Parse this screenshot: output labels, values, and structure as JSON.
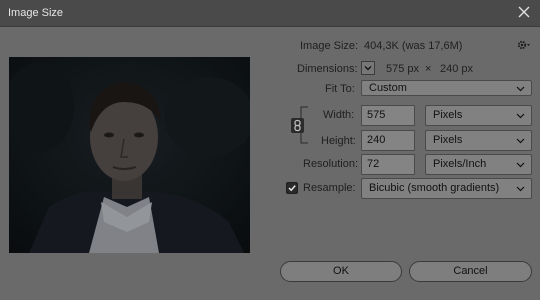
{
  "window": {
    "title": "Image Size"
  },
  "image_size": {
    "label": "Image Size:",
    "value": "404,3K (was 17,6M)"
  },
  "dimensions": {
    "label": "Dimensions:",
    "width_value": "575 px",
    "times": "×",
    "height_value": "240 px"
  },
  "fit_to": {
    "label": "Fit To:",
    "value": "Custom"
  },
  "width": {
    "label": "Width:",
    "value": "575",
    "unit": "Pixels"
  },
  "height": {
    "label": "Height:",
    "value": "240",
    "unit": "Pixels"
  },
  "resolution": {
    "label": "Resolution:",
    "value": "72",
    "unit": "Pixels/Inch"
  },
  "resample": {
    "label": "Resample:",
    "checked": true,
    "value": "Bicubic (smooth gradients)"
  },
  "buttons": {
    "ok": "OK",
    "cancel": "Cancel"
  },
  "icons": {
    "close": "close-icon",
    "gear": "gear-icon",
    "chevron": "chevron-down-icon",
    "link": "link-icon",
    "check": "check-icon"
  }
}
